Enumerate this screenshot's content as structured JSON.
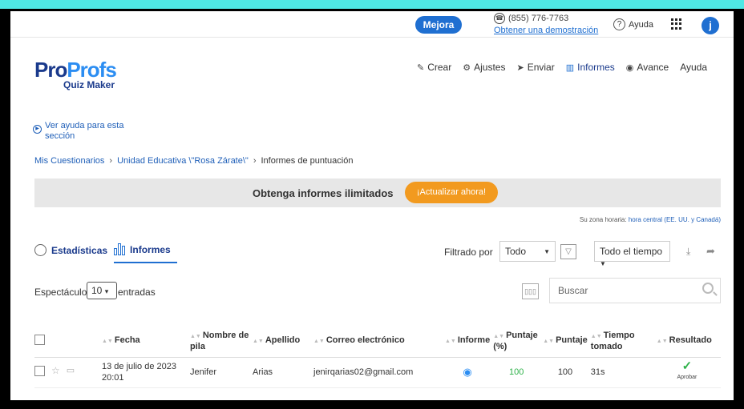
{
  "topbar": {
    "upgrade_label": "Mejora",
    "phone": "(855) 776-7763",
    "demo_link": "Obtener una demostración",
    "help_label": "Ayuda",
    "avatar_letter": "j"
  },
  "logo": {
    "part1": "Pro",
    "part2": "Profs",
    "sub": "Quiz Maker"
  },
  "nav": {
    "create": "Crear",
    "settings": "Ajustes",
    "send": "Enviar",
    "reports": "Informes",
    "progress": "Avance",
    "help": "Ayuda"
  },
  "help_link": "Ver ayuda para esta sección",
  "breadcrumb": {
    "item1": "Mis Cuestionarios",
    "item2": "Unidad Educativa \\\"Rosa Zárate\\\"",
    "item3": "Informes de puntuación",
    "sep": "›"
  },
  "banner": {
    "text": "Obtenga informes ilimitados",
    "button": "¡Actualizar ahora!"
  },
  "timezone": {
    "label": "Su zona horaria:",
    "value": "hora central (EE. UU. y Canadá)"
  },
  "tabs": {
    "stats": "Estadísticas",
    "reports": "Informes"
  },
  "filters": {
    "label": "Filtrado por",
    "status": "Todo",
    "time": "Todo el tiempo"
  },
  "listing": {
    "show_label": "Espectáculo",
    "page_size": "10",
    "entries_label": "entradas",
    "search_placeholder": "Buscar"
  },
  "table": {
    "headers": {
      "date": "Fecha",
      "first_name": "Nombre de pila",
      "last_name": "Apellido",
      "email": "Correo electrónico",
      "report": "Informe",
      "score_pct": "Puntaje (%)",
      "score": "Puntaje",
      "time": "Tiempo tomado",
      "result": "Resultado"
    },
    "rows": [
      {
        "date": "13 de julio de 2023 20:01",
        "first_name": "Jenifer",
        "last_name": "Arias",
        "email": "jenirqarias02@gmail.com",
        "score_pct": "100",
        "score": "100",
        "time": "31s",
        "result": "Aprobar"
      }
    ]
  }
}
